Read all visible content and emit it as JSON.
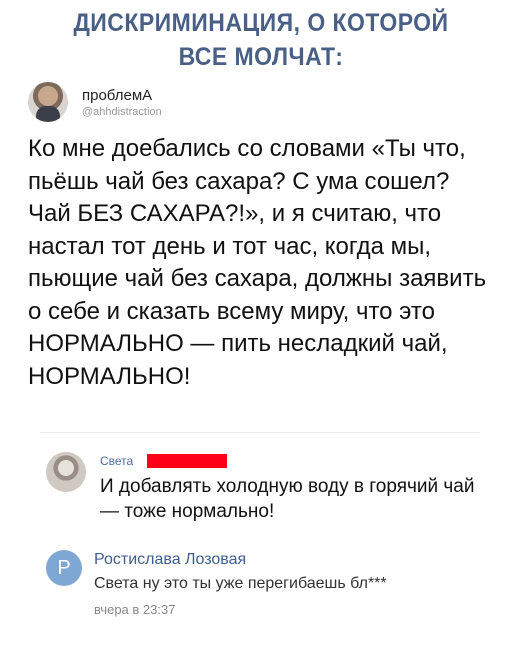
{
  "headline": {
    "line1": "ДИСКРИМИНАЦИЯ, О КОТОРОЙ",
    "line2": "ВСЕ МОЛЧАТ:"
  },
  "post": {
    "author": "проблемА",
    "handle": "@ahhdistraction",
    "text": "Ко мне доебались со словами «Ты что, пьёшь чай без сахара? С ума сошел? Чай БЕЗ САХАРА?!», и я считаю, что настал тот день и тот час, когда мы, пьющие чай без сахара, должны заявить о себе и сказать всему миру, что это НОРМАЛЬНО — пить несладкий чай, НОРМАЛЬНО!"
  },
  "comments": [
    {
      "author": "Света",
      "text": "И добавлять холодную воду в горячий чай — тоже нормально!"
    },
    {
      "author": "Ростислава Лозовая",
      "avatar_initial": "Р",
      "text": "Света ну это ты уже перегибаешь бл***",
      "time": "вчера в 23:37"
    }
  ],
  "colors": {
    "headline": "#4a5f86",
    "redaction": "#ff0019",
    "link": "#4a6ea0"
  }
}
